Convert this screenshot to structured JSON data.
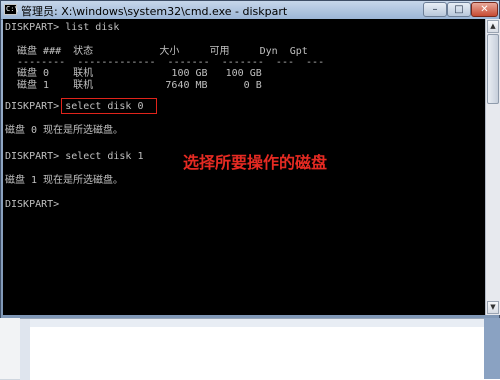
{
  "window": {
    "title": "管理员: X:\\windows\\system32\\cmd.exe - diskpart",
    "app_icon": "C:\\",
    "controls": {
      "minimize": "–",
      "maximize": "□",
      "close": "✕"
    }
  },
  "console": {
    "lines": [
      "DISKPART> list disk",
      "",
      "  磁盘 ###  状态           大小     可用     Dyn  Gpt",
      "  --------  -------------  -------  -------  ---  ---",
      "  磁盘 0    联机             100 GB   100 GB",
      "  磁盘 1    联机            7640 MB      0 B",
      "",
      "DISKPART> select disk 0",
      "",
      "磁盘 0 现在是所选磁盘。",
      "",
      "DISKPART> select disk 1",
      "",
      "磁盘 1 现在是所选磁盘。",
      "",
      "DISKPART>"
    ]
  },
  "annotation": {
    "text": "选择所要操作的磁盘",
    "color": "#e52a22"
  },
  "highlight": {
    "target": "select disk 0",
    "color": "#e0241b"
  },
  "scrollbar": {
    "up_icon": "▲",
    "down_icon": "▼"
  }
}
